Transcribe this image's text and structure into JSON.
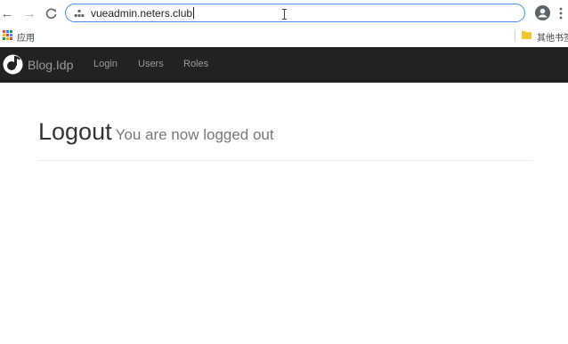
{
  "browser": {
    "url": "vueadmin.neters.club",
    "bookmarks": {
      "apps_label": "应用",
      "other_label": "其他书签"
    }
  },
  "navbar": {
    "brand": "Blog.Idp",
    "links": [
      "Login",
      "Users",
      "Roles"
    ]
  },
  "page": {
    "title": "Logout",
    "subtitle": "You are now logged out"
  }
}
